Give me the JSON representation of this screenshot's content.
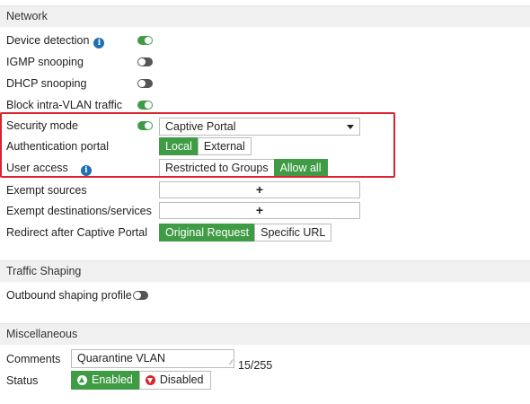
{
  "network": {
    "header": "Network",
    "device_detection": "Device detection",
    "igmp_snooping": "IGMP snooping",
    "dhcp_snooping": "DHCP snooping",
    "block_intra_vlan": "Block intra-VLAN traffic",
    "security_mode": "Security mode",
    "security_mode_value": "Captive Portal",
    "auth_portal": "Authentication portal",
    "auth_portal_options": [
      "Local",
      "External"
    ],
    "auth_portal_selected": "Local",
    "user_access": "User access",
    "user_access_options": [
      "Restricted to Groups",
      "Allow all"
    ],
    "user_access_selected": "Allow all",
    "exempt_sources": "Exempt sources",
    "exempt_destinations": "Exempt destinations/services",
    "plus": "+",
    "redirect": "Redirect after Captive Portal",
    "redirect_options": [
      "Original Request",
      "Specific URL"
    ],
    "redirect_selected": "Original Request"
  },
  "traffic_shaping": {
    "header": "Traffic Shaping",
    "outbound_profile": "Outbound shaping profile"
  },
  "misc": {
    "header": "Miscellaneous",
    "comments_label": "Comments",
    "comments_value": "Quarantine VLAN",
    "counter": "15/255",
    "status_label": "Status",
    "status_enabled": "Enabled",
    "status_disabled": "Disabled"
  },
  "toggles": {
    "device_detection": true,
    "igmp_snooping": false,
    "dhcp_snooping": false,
    "block_intra_vlan": true,
    "security_mode": true,
    "outbound_profile": false
  },
  "icons": {
    "info": "info-icon",
    "dropdown": "chevron-down-icon",
    "enabled": "arrow-up-circle-icon",
    "disabled": "arrow-down-circle-icon"
  },
  "colors": {
    "accent_green": "#3f9c45",
    "highlight_red": "#d9242b",
    "info_blue": "#1f6fb2"
  }
}
